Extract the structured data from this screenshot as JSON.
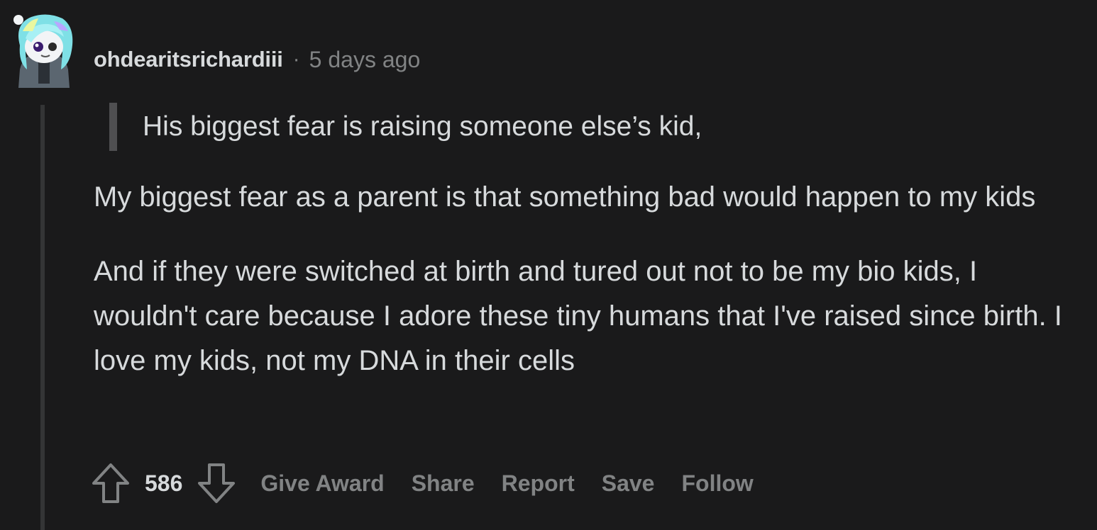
{
  "comment": {
    "username": "ohdearitsrichardiii",
    "separator": "·",
    "timestamp": "5 days ago",
    "quote": "His biggest fear is raising someone else’s kid,",
    "paragraphs": [
      "My biggest fear as a parent is that something bad would happen to my kids",
      "And if they were switched at birth and tured out not to be my bio kids, I wouldn't care because I adore these tiny humans that I've raised since birth. I love my kids, not my DNA in their cells"
    ],
    "score": "586",
    "actions": {
      "give_award": "Give Award",
      "share": "Share",
      "report": "Report",
      "save": "Save",
      "follow": "Follow"
    }
  },
  "icons": {
    "avatar": "snoo-avatar-icon",
    "upvote": "upvote-arrow-icon",
    "downvote": "downvote-arrow-icon"
  },
  "colors": {
    "background": "#1a1a1b",
    "text": "#d7dadc",
    "muted": "#818384",
    "thread_line": "#343536",
    "quote_bar": "#4f4f51",
    "avatar_hair": "#7fe0e6"
  }
}
